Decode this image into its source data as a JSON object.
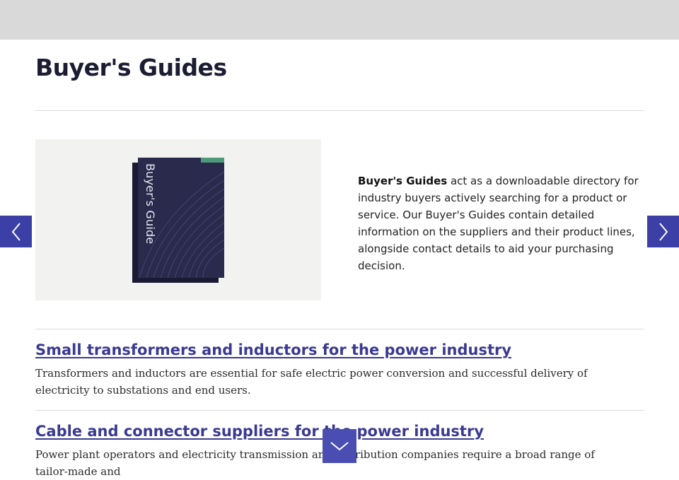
{
  "page": {
    "title": "Buyer's Guides"
  },
  "hero": {
    "book_cover_text": "Buyer's Guide",
    "intro_bold": "Buyer's Guides",
    "intro_text": " act as a downloadable directory for industry buyers actively searching for a product or service. Our Buyer's Guides contain detailed information on the suppliers and their product lines, alongside contact details to aid your purchasing decision."
  },
  "guides": [
    {
      "title": "Small transformers and inductors for the power industry",
      "description": "Transformers and inductors are essential for safe electric power conversion and successful delivery of electricity to substations and end users."
    },
    {
      "title": "Cable and connector suppliers for the power industry",
      "description": "Power plant operators and electricity transmission and distribution companies require a broad range of tailor-made and"
    }
  ],
  "icons": {
    "prev": "chevron-left-icon",
    "next": "chevron-right-icon",
    "scroll": "chevron-down-icon"
  },
  "colors": {
    "accent": "#3b3fa6",
    "link": "#3a3a92",
    "book": "#2a2a4d",
    "book_accent": "#4c9a7a",
    "header_bar": "#d9d9d9"
  }
}
